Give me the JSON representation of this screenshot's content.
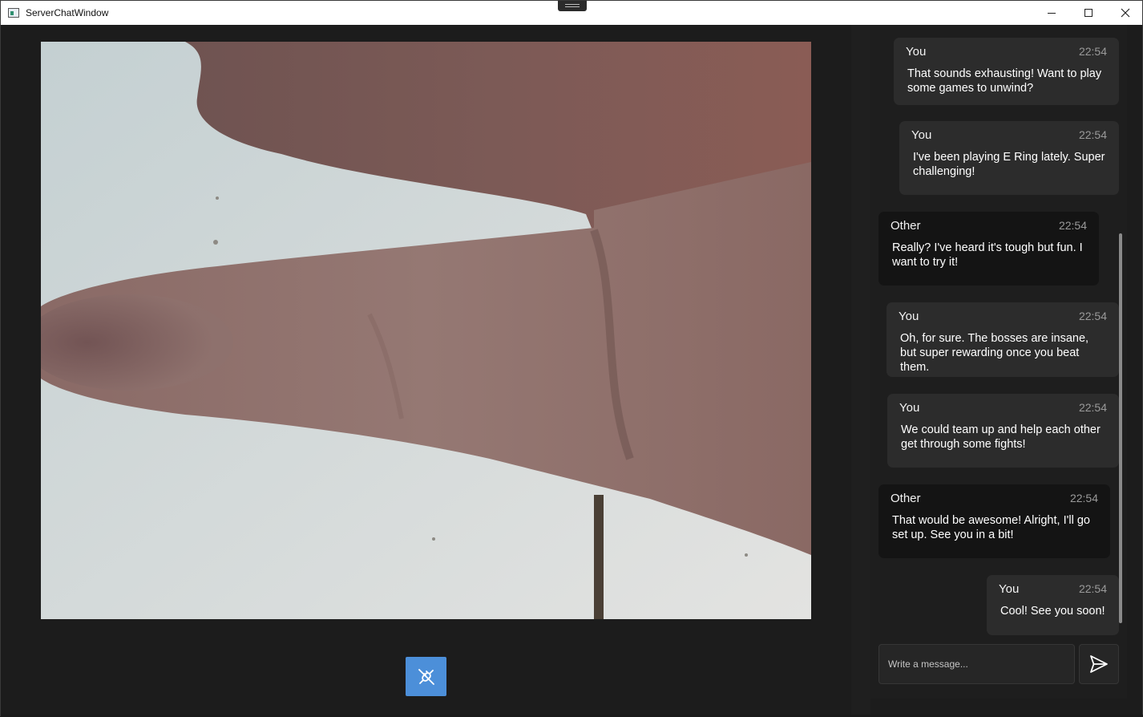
{
  "window": {
    "title": "ServerChatWindow"
  },
  "video": {
    "description_icon": "webcam-feed"
  },
  "controls": {
    "connect_icon": "plug-disconnect-icon"
  },
  "chat": {
    "messages": [
      {
        "sender": "You",
        "time": "22:54",
        "text": "That sounds exhausting! Want to play some games to unwind?"
      },
      {
        "sender": "You",
        "time": "22:54",
        "text": "I've been playing E Ring lately. Super challenging!"
      },
      {
        "sender": "Other",
        "time": "22:54",
        "text": "Really? I've heard it's tough but fun. I want to try it!"
      },
      {
        "sender": "You",
        "time": "22:54",
        "text": "Oh, for sure. The bosses are insane, but super rewarding once you beat them."
      },
      {
        "sender": "You",
        "time": "22:54",
        "text": "We could team up and help each other get through some fights!"
      },
      {
        "sender": "Other",
        "time": "22:54",
        "text": "That would be awesome! Alright, I'll go set up. See you in a bit!"
      },
      {
        "sender": "You",
        "time": "22:54",
        "text": "Cool! See you soon!"
      }
    ],
    "input": {
      "placeholder": "Write a message...",
      "value": ""
    },
    "send_icon": "send-icon"
  },
  "colors": {
    "accent": "#4c8fd9",
    "you_bubble": "#2c2c2c",
    "other_bubble": "#141414",
    "background": "#1c1c1c"
  }
}
